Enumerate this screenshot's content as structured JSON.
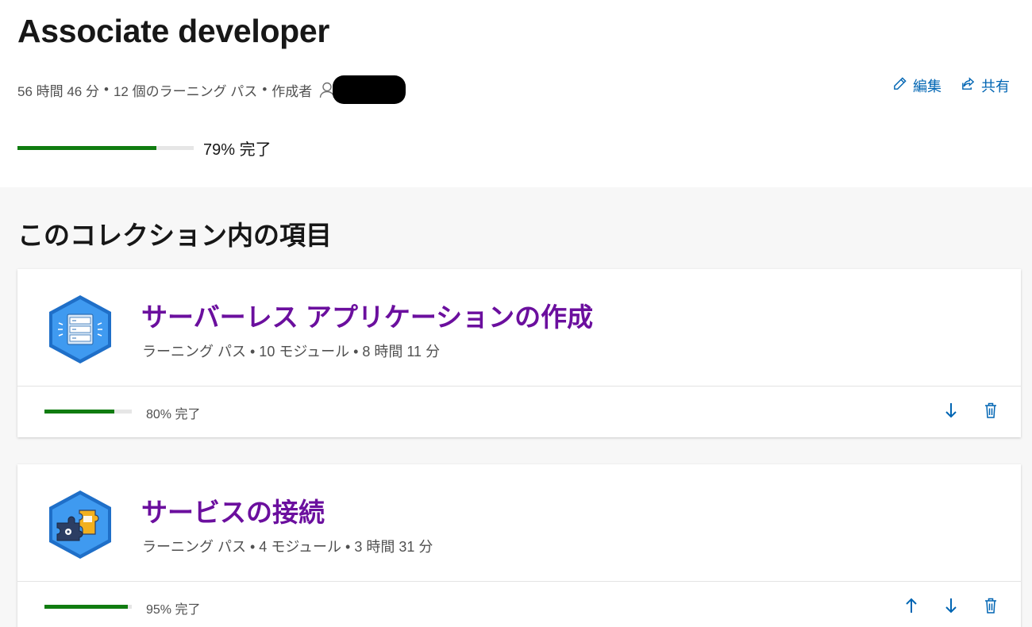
{
  "collection": {
    "title": "Associate developer",
    "meta": {
      "duration": "56 時間 46 分",
      "paths": "12 個のラーニング パス",
      "author_label": "作成者"
    },
    "actions": {
      "edit": "編集",
      "share": "共有"
    },
    "progress": {
      "percent": 79,
      "label": "79% 完了"
    }
  },
  "section": {
    "title": "このコレクション内の項目",
    "items": [
      {
        "title": "サーバーレス アプリケーションの作成",
        "meta": "ラーニング パス • 10 モジュール • 8 時間 11 分",
        "progress_percent": 80,
        "progress_label": "80% 完了",
        "icon": "server-hexagon-icon"
      },
      {
        "title": "サービスの接続",
        "meta": "ラーニング パス • 4 モジュール • 3 時間 31 分",
        "progress_percent": 95,
        "progress_label": "95% 完了",
        "icon": "puzzle-hexagon-icon"
      }
    ]
  },
  "colors": {
    "accent": "#0065b3",
    "title_purple": "#6b0f9e",
    "progress_green": "#107c10"
  }
}
